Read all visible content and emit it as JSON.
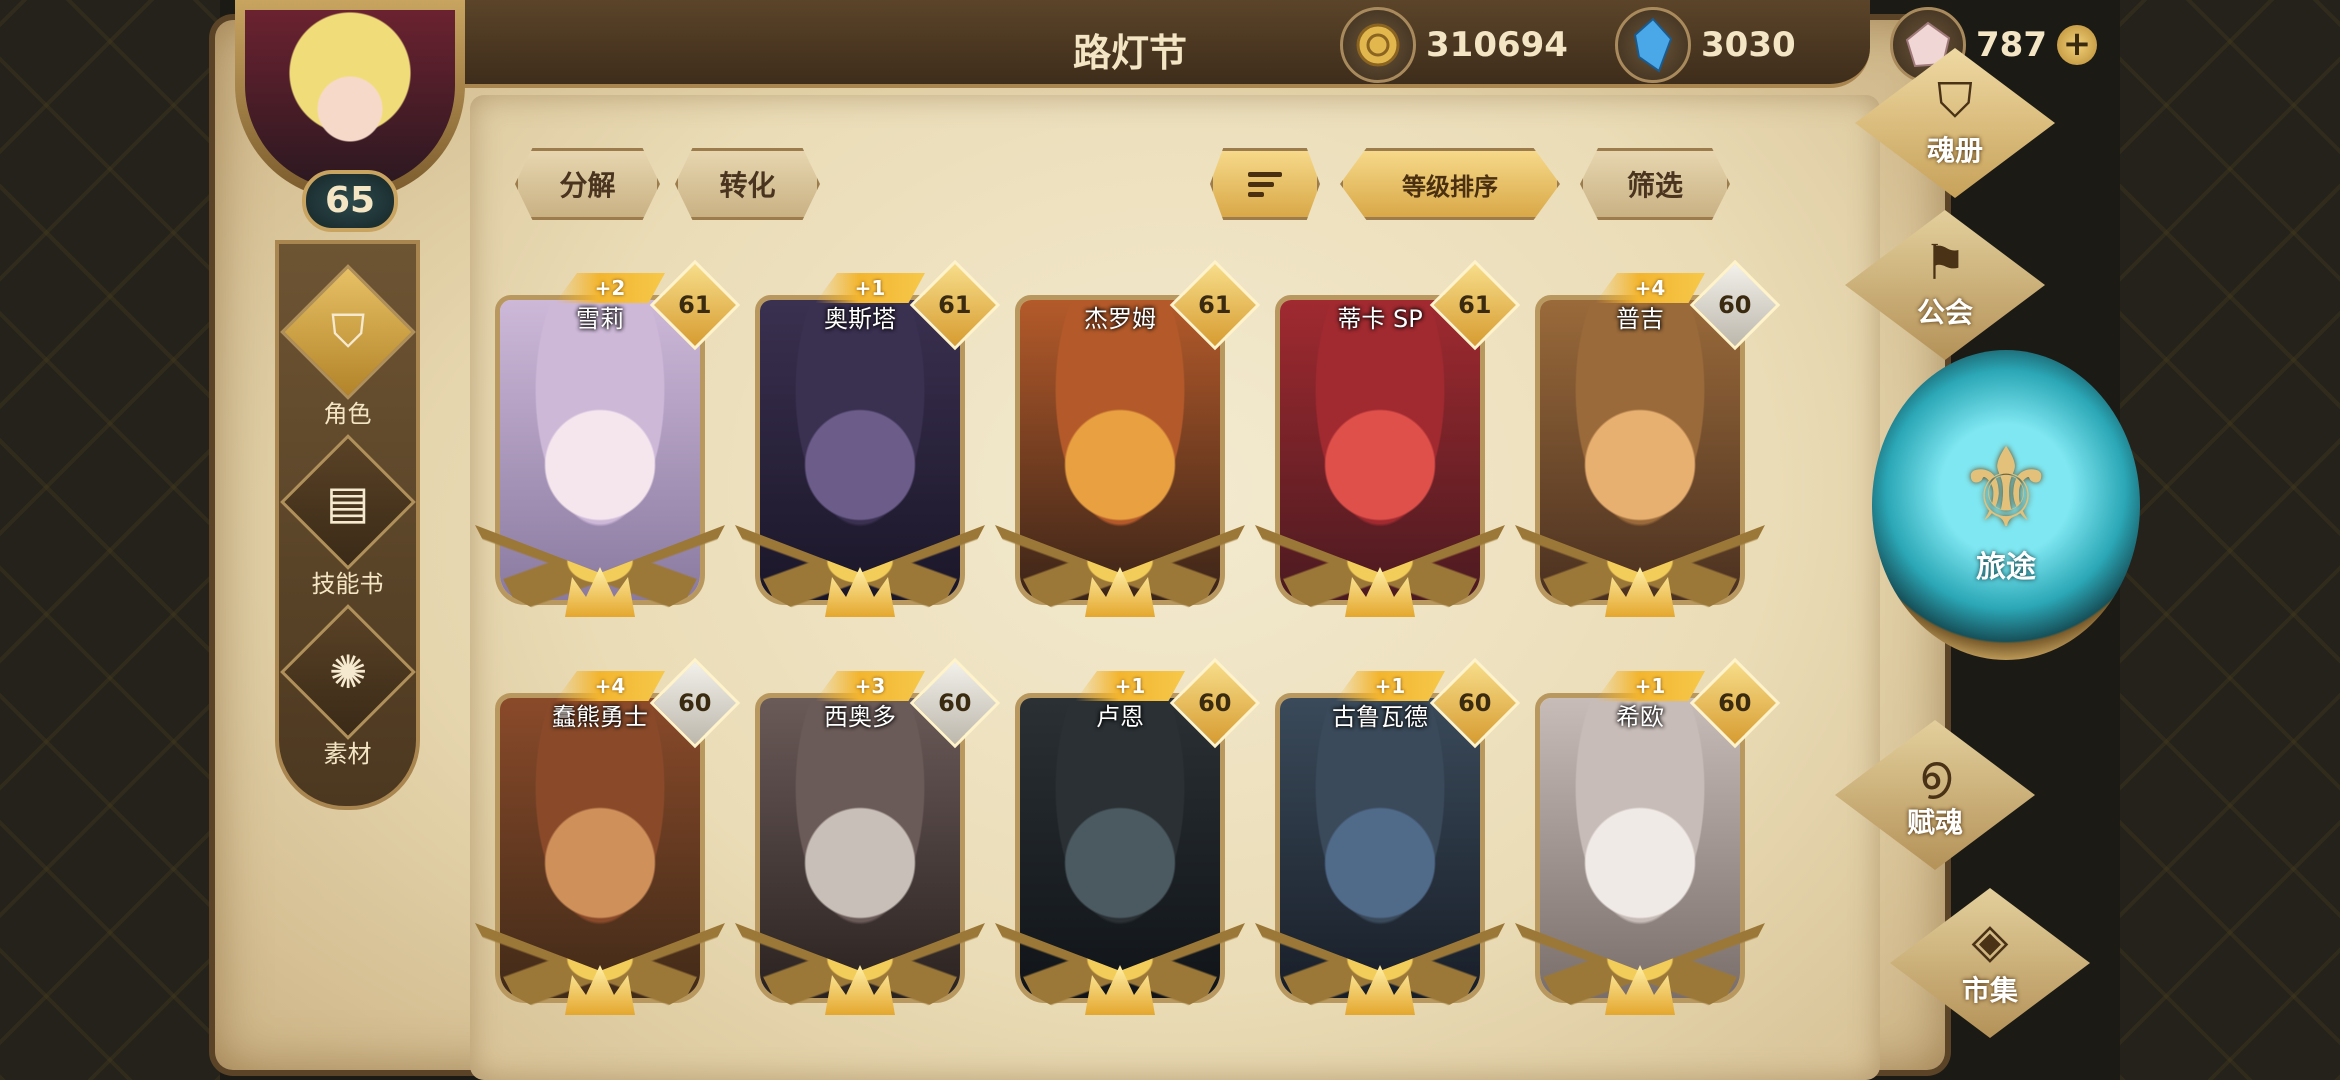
{
  "player": {
    "name": "路灯节",
    "level": "65"
  },
  "resources": {
    "gold": {
      "icon": "gold-coin-icon",
      "value": "310694"
    },
    "gem": {
      "icon": "blue-crystal-icon",
      "value": "3030"
    },
    "crystal": {
      "icon": "pink-crystal-icon",
      "value": "787",
      "plus": "+"
    }
  },
  "left_nav": [
    {
      "label": "角色",
      "icon": "helmet-icon",
      "active": true
    },
    {
      "label": "技能书",
      "icon": "book-icon",
      "active": false
    },
    {
      "label": "素材",
      "icon": "material-icon",
      "active": false
    }
  ],
  "toolbar": {
    "decompose": "分解",
    "convert": "转化",
    "sort_icon": "sort-icon",
    "level_sort": "等级排序",
    "filter": "筛选"
  },
  "heroes": [
    {
      "name": "雪莉",
      "plus": "+2",
      "level": "61"
    },
    {
      "name": "奥斯塔",
      "plus": "+1",
      "level": "61"
    },
    {
      "name": "杰罗姆",
      "plus": "",
      "level": "61"
    },
    {
      "name": "蒂卡 SP",
      "plus": "",
      "level": "61"
    },
    {
      "name": "普吉",
      "plus": "+4",
      "level": "60"
    },
    {
      "name": "蠢熊勇士",
      "plus": "+4",
      "level": "60"
    },
    {
      "name": "西奥多",
      "plus": "+3",
      "level": "60"
    },
    {
      "name": "卢恩",
      "plus": "+1",
      "level": "60"
    },
    {
      "name": "古鲁瓦德",
      "plus": "+1",
      "level": "60"
    },
    {
      "name": "希欧",
      "plus": "+1",
      "level": "60"
    }
  ],
  "right_menu": {
    "soulbook": "魂册",
    "guild": "公会",
    "journey": "旅途",
    "talent": "赋魂",
    "market": "市集"
  }
}
